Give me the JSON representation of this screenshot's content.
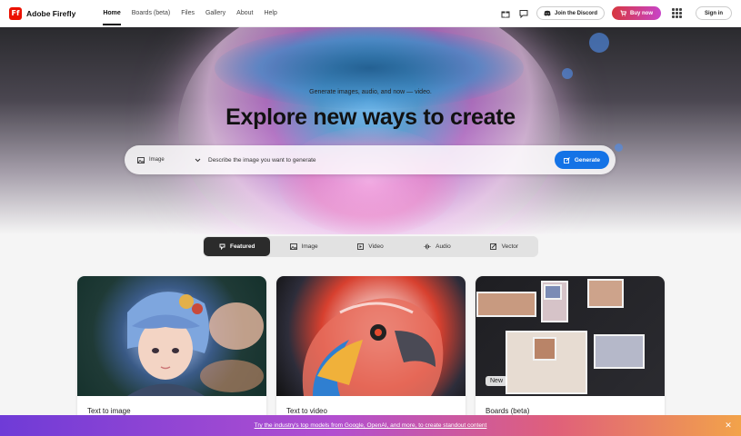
{
  "app": {
    "name": "Adobe Firefly",
    "logo_glyph": "Ff",
    "brand_color": "#eb1000"
  },
  "nav": [
    {
      "label": "Home",
      "active": true
    },
    {
      "label": "Boards (beta)",
      "active": false
    },
    {
      "label": "Files",
      "active": false
    },
    {
      "label": "Gallery",
      "active": false
    },
    {
      "label": "About",
      "active": false
    },
    {
      "label": "Help",
      "active": false
    }
  ],
  "header_actions": {
    "gift_icon": "gift-icon",
    "chat_icon": "chat-icon",
    "discord_label": "Join the Discord",
    "buy_label": "Buy now",
    "apps_icon": "apps-grid-icon",
    "signin_label": "Sign in"
  },
  "hero": {
    "subtitle": "Generate images, audio, and now — video.",
    "title": "Explore new ways to create",
    "mode_label": "Image",
    "prompt_placeholder": "Describe the image you want to generate",
    "generate_label": "Generate",
    "accent_color": "#1473e6"
  },
  "tabs": [
    {
      "label": "Featured",
      "icon": "lightbulb-icon",
      "active": true
    },
    {
      "label": "Image",
      "icon": "image-icon",
      "active": false
    },
    {
      "label": "Video",
      "icon": "video-icon",
      "active": false
    },
    {
      "label": "Audio",
      "icon": "audio-icon",
      "active": false
    },
    {
      "label": "Vector",
      "icon": "vector-icon",
      "active": false
    }
  ],
  "cards": [
    {
      "label": "Text to image",
      "badge": ""
    },
    {
      "label": "Text to video",
      "badge": ""
    },
    {
      "label": "Boards (beta)",
      "badge": "New"
    }
  ],
  "banner": {
    "text": "Try the industry's top models from Google, OpenAI, and more, to create standout content",
    "close_icon": "close-icon"
  }
}
